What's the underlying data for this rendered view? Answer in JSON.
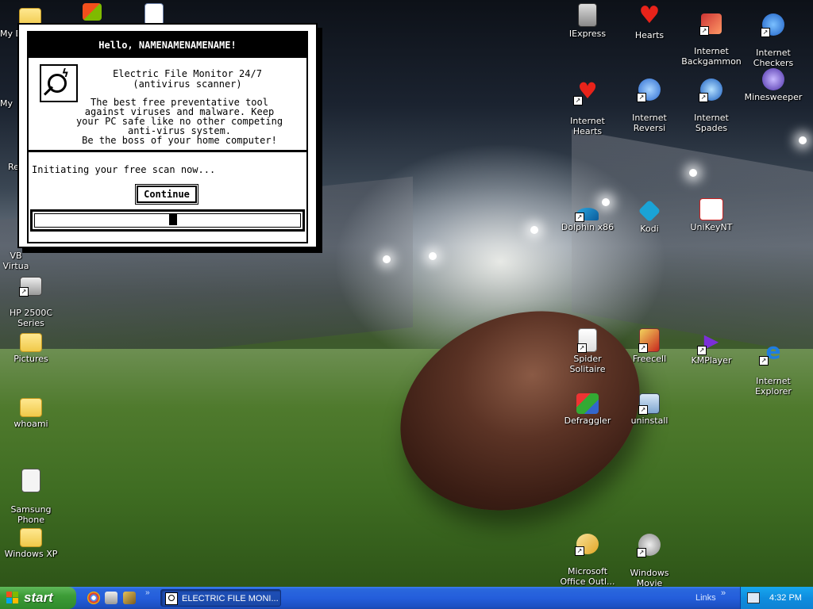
{
  "dialog": {
    "title": "Hello, NAMENAMENAMENAME!",
    "product_line1": "Electric File Monitor 24/7",
    "product_line2": "(antivirus scanner)",
    "desc_lines": [
      "The best free preventative tool",
      "against viruses and malware. Keep",
      "your PC safe like no other competing",
      "anti-virus system.",
      "Be the boss of your home computer!"
    ],
    "scan_message": "Initiating your free scan now...",
    "continue_label": "Continue",
    "progress_fraction": 0.52
  },
  "desktop_icons_left": [
    {
      "label": "My D"
    },
    {
      "label": "My"
    },
    {
      "label": "Re"
    },
    {
      "label": "VB\nVirtua"
    },
    {
      "label": "HP 2500C\nSeries"
    },
    {
      "label": "Pictures"
    },
    {
      "label": "whoami"
    },
    {
      "label": "Samsung\nPhone"
    },
    {
      "label": "Windows XP"
    }
  ],
  "desktop_icons_right": [
    {
      "label": "IExpress"
    },
    {
      "label": "Hearts"
    },
    {
      "label": "Internet\nBackgammon"
    },
    {
      "label": "Internet\nCheckers"
    },
    {
      "label": "Internet\nHearts"
    },
    {
      "label": "Internet\nReversi"
    },
    {
      "label": "Internet\nSpades"
    },
    {
      "label": "Minesweeper"
    },
    {
      "label": "Dolphin x86"
    },
    {
      "label": "Kodi"
    },
    {
      "label": "UniKeyNT"
    },
    {
      "label": "Spider Solitaire"
    },
    {
      "label": "Freecell"
    },
    {
      "label": "KMPlayer"
    },
    {
      "label": "Internet\nExplorer"
    },
    {
      "label": "Defraggler"
    },
    {
      "label": "uninstall"
    },
    {
      "label": "Microsoft\nOffice Outl..."
    },
    {
      "label": "Windows Movie\nMaker"
    }
  ],
  "taskbar": {
    "start_label": "start",
    "task_label": "ELECTRIC FILE MONI...",
    "links_label": "Links",
    "links_arrow": "»",
    "quicklaunch_more": "»",
    "clock": "4:32 PM"
  },
  "colors": {
    "taskbar_blue": "#245edb",
    "start_green": "#3d9c37",
    "tray_blue": "#0f8ddf"
  }
}
